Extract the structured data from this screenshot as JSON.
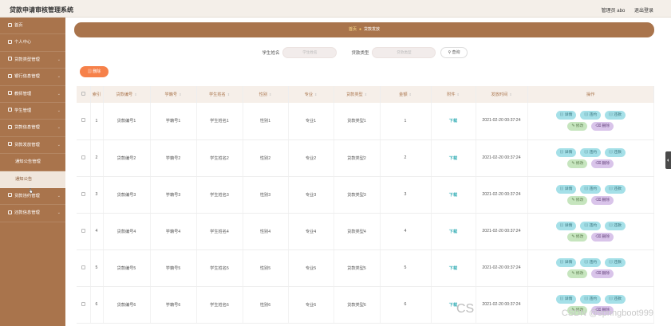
{
  "app": {
    "title": "贷款申请审核管理系统",
    "admin": "管理员 abo",
    "logout": "退出登录"
  },
  "sidebar": {
    "items": [
      {
        "label": "首页",
        "sub": false,
        "active": false
      },
      {
        "label": "个人中心",
        "sub": false,
        "active": false
      },
      {
        "label": "贷款类型管理",
        "sub": false,
        "active": false
      },
      {
        "label": "银行信息管理",
        "sub": false,
        "active": false
      },
      {
        "label": "教师管理",
        "sub": false,
        "active": false
      },
      {
        "label": "学生管理",
        "sub": false,
        "active": false
      },
      {
        "label": "贷款信息管理",
        "sub": false,
        "active": false
      },
      {
        "label": "贷款发放管理",
        "sub": false,
        "active": false
      },
      {
        "label": "通知公告管理",
        "sub": true,
        "active": false
      },
      {
        "label": "通知公告",
        "sub": true,
        "active": true
      },
      {
        "label": "贷款违约管理",
        "sub": false,
        "active": false
      },
      {
        "label": "还款信息管理",
        "sub": false,
        "active": false
      }
    ]
  },
  "breadcrumb": {
    "home": "首页",
    "current": "贷款发放"
  },
  "search": {
    "name_label": "学生姓名",
    "name_placeholder": "学生姓名",
    "type_label": "贷款类型",
    "type_placeholder": "贷款类型",
    "button": "查询"
  },
  "toolbar": {
    "delete": "删除"
  },
  "table": {
    "headers": [
      "索引",
      "贷款编号",
      "学籍号",
      "学生姓名",
      "性别",
      "专业",
      "贷款类型",
      "金额",
      "附件",
      "发放时间",
      "操作"
    ],
    "rows": [
      {
        "index": "1",
        "loan_no": "贷款编号1",
        "student_no": "学籍号1",
        "name": "学生姓名1",
        "gender": "性别1",
        "major": "专业1",
        "loan_type": "贷款类型1",
        "amount": "1",
        "attachment": "下载",
        "time": "2021-02-20 00:37:24"
      },
      {
        "index": "2",
        "loan_no": "贷款编号2",
        "student_no": "学籍号2",
        "name": "学生姓名2",
        "gender": "性别2",
        "major": "专业2",
        "loan_type": "贷款类型2",
        "amount": "2",
        "attachment": "下载",
        "time": "2021-02-20 00:37:24"
      },
      {
        "index": "3",
        "loan_no": "贷款编号3",
        "student_no": "学籍号3",
        "name": "学生姓名3",
        "gender": "性别3",
        "major": "专业3",
        "loan_type": "贷款类型3",
        "amount": "3",
        "attachment": "下载",
        "time": "2021-02-20 00:37:24"
      },
      {
        "index": "4",
        "loan_no": "贷款编号4",
        "student_no": "学籍号4",
        "name": "学生姓名4",
        "gender": "性别4",
        "major": "专业4",
        "loan_type": "贷款类型4",
        "amount": "4",
        "attachment": "下载",
        "time": "2021-02-20 00:37:24"
      },
      {
        "index": "5",
        "loan_no": "贷款编号5",
        "student_no": "学籍号5",
        "name": "学生姓名5",
        "gender": "性别5",
        "major": "专业5",
        "loan_type": "贷款类型5",
        "amount": "5",
        "attachment": "下载",
        "time": "2021-02-20 00:37:24"
      },
      {
        "index": "6",
        "loan_no": "贷款编号6",
        "student_no": "学籍号6",
        "name": "学生姓名6",
        "gender": "性别6",
        "major": "专业6",
        "loan_type": "贷款类型6",
        "amount": "6",
        "attachment": "下载",
        "time": "2021-02-20 00:37:24"
      }
    ],
    "actions": {
      "detail": "详情",
      "default": "违约",
      "repay": "还款",
      "edit": "修改",
      "delete": "删除"
    }
  },
  "watermark": "CSDN @springboot999",
  "watermark_cs": "CS"
}
